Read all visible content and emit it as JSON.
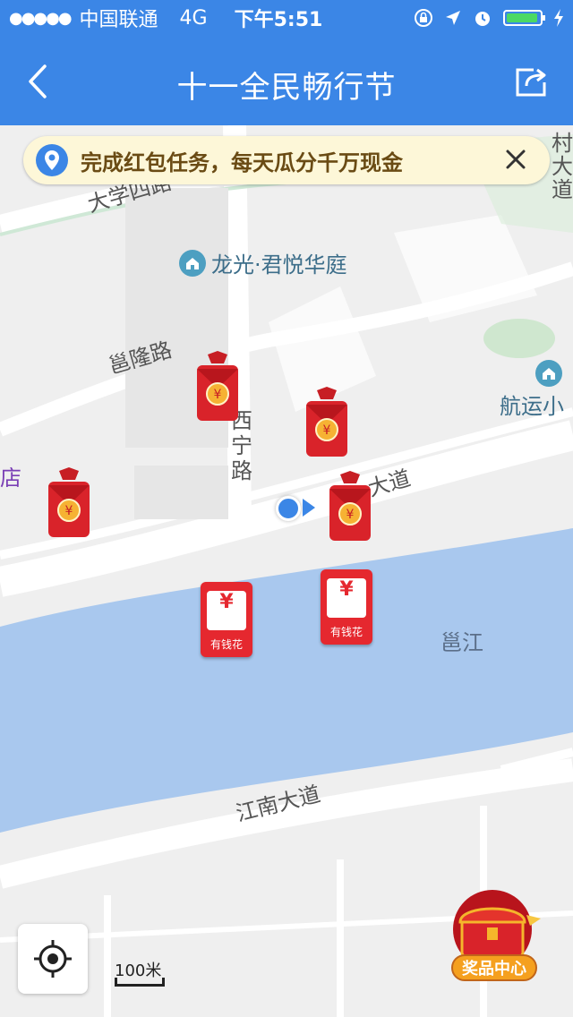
{
  "status_bar": {
    "signal": "●●●●●",
    "carrier": "中国联通",
    "network": "4G",
    "time": "下午5:51"
  },
  "nav": {
    "title": "十一全民畅行节"
  },
  "banner": {
    "text": "完成红包任务，每天瓜分千万现金"
  },
  "map": {
    "roads": [
      "大学四路",
      "邕隆路",
      "西宁路",
      "大道",
      "江南大道"
    ],
    "water": "邕江",
    "poi": [
      "龙光·君悦华庭",
      "航运小"
    ],
    "edge_labels": [
      "村",
      "大",
      "道",
      "店"
    ],
    "scale": "100米",
    "envelopes": {
      "coin_symbol": "¥"
    },
    "yqh_cards": [
      {
        "symbol": "¥",
        "name": "有钱花"
      },
      {
        "symbol": "¥",
        "name": "有钱花"
      }
    ]
  },
  "prize_center": {
    "label": "奖品中心"
  },
  "colors": {
    "primary": "#3b86e6",
    "water": "#a9c8ee",
    "envelope": "#d9232a",
    "banner_bg": "#fdf7d8"
  }
}
